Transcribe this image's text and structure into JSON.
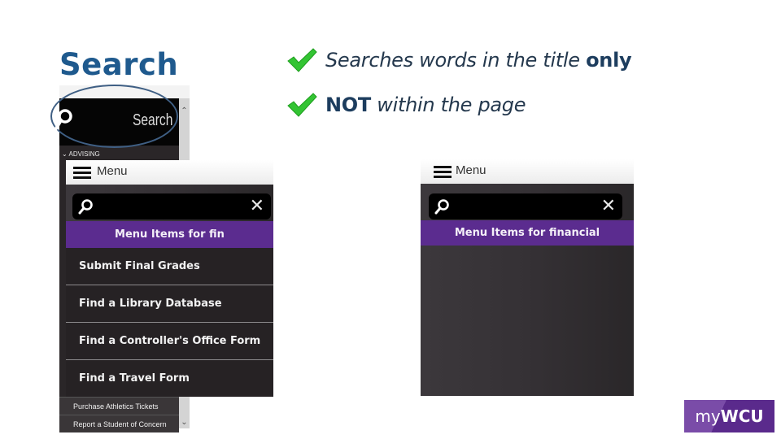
{
  "slide": {
    "title": "Search",
    "bullets": [
      {
        "text": "Searches words in the title ",
        "emphasis": "only",
        "icon": "check-icon"
      },
      {
        "emphasis": "NOT",
        "text": " within the page",
        "icon": "check-icon"
      }
    ]
  },
  "background_app": {
    "search_label": "Search",
    "section": "ADVISING",
    "rows": [
      "Purchase Athletics Tickets",
      "Report a Student of Concern"
    ]
  },
  "panel_left": {
    "menu_label": "Menu",
    "search_value": "",
    "results_header": "Menu Items for fin",
    "items": [
      "Submit Final Grades",
      "Find a Library Database",
      "Find a Controller's Office Form",
      "Find a Travel Form"
    ]
  },
  "panel_right": {
    "menu_label": "Menu",
    "search_value": "",
    "results_header": "Menu Items for financial",
    "items": []
  },
  "logo": {
    "prefix": "my",
    "brand": "WCU"
  },
  "colors": {
    "title": "#1f5a8e",
    "purple": "#5b2c8f",
    "check": "#3cc13c"
  }
}
